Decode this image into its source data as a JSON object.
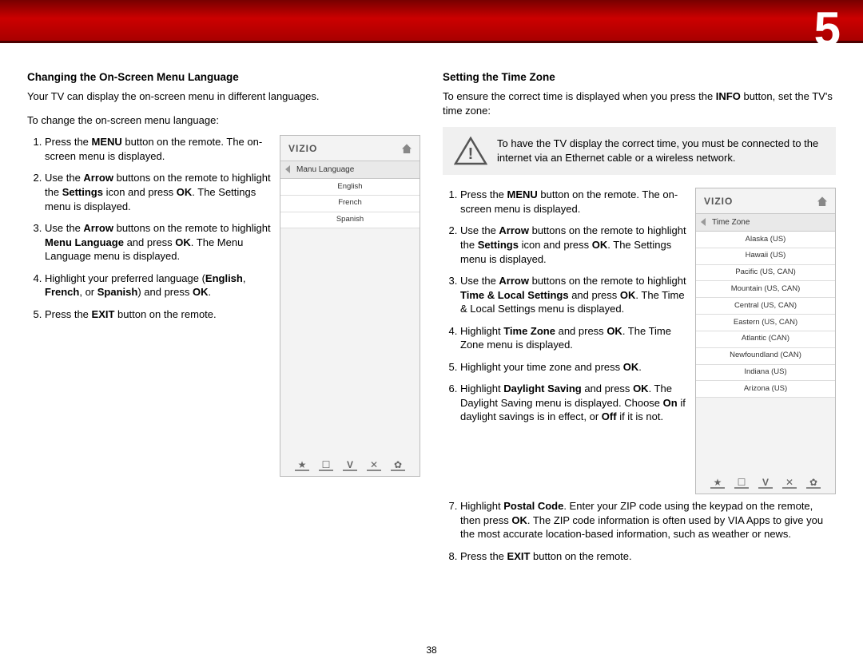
{
  "chapter_number": "5",
  "page_number": "38",
  "left": {
    "title": "Changing the On-Screen Menu Language",
    "intro": "Your TV can display the on-screen menu in different languages.",
    "subintro": "To change the on-screen menu language:",
    "steps": {
      "s1a": "Press the ",
      "s1b": "MENU",
      "s1c": " button on the remote. The on-screen menu is displayed.",
      "s2a": "Use the ",
      "s2b": "Arrow",
      "s2c": " buttons on the remote to highlight the ",
      "s2d": "Settings",
      "s2e": " icon and press ",
      "s2f": "OK",
      "s2g": ". The Settings menu is displayed.",
      "s3a": "Use the ",
      "s3b": "Arrow",
      "s3c": " buttons on the remote to highlight ",
      "s3d": "Menu Language",
      "s3e": " and press ",
      "s3f": "OK",
      "s3g": ". The Menu Language menu is displayed.",
      "s4a": "Highlight your preferred language (",
      "s4b": "English",
      "s4c": ", ",
      "s4d": "French",
      "s4e": ", or ",
      "s4f": "Spanish",
      "s4g": ") and press ",
      "s4h": "OK",
      "s4i": ".",
      "s5a": "Press the ",
      "s5b": "EXIT",
      "s5c": " button on the remote."
    },
    "panel": {
      "brand": "VIZIO",
      "menu_title": "Manu Language",
      "items": [
        "English",
        "French",
        "Spanish"
      ]
    }
  },
  "right": {
    "title": "Setting the Time Zone",
    "intro_a": "To ensure the correct time is displayed when you press the ",
    "intro_b": "INFO",
    "intro_c": " button, set the TV's time zone:",
    "warning": "To have the TV display the correct time, you must be connected to the internet via an Ethernet cable or a wireless network.",
    "steps": {
      "s1a": "Press the ",
      "s1b": "MENU",
      "s1c": " button on the remote. The on-screen menu is displayed.",
      "s2a": "Use the ",
      "s2b": "Arrow",
      "s2c": " buttons on the remote to highlight the ",
      "s2d": "Settings",
      "s2e": " icon and press ",
      "s2f": "OK",
      "s2g": ". The Settings menu is displayed.",
      "s3a": "Use the ",
      "s3b": "Arrow",
      "s3c": " buttons on the remote to highlight ",
      "s3d": "Time & Local Settings",
      "s3e": " and press ",
      "s3f": "OK",
      "s3g": ". The Time & Local Settings menu is displayed.",
      "s4a": "Highlight ",
      "s4b": "Time Zone",
      "s4c": " and press ",
      "s4d": "OK",
      "s4e": ". The Time Zone menu is displayed.",
      "s5a": "Highlight your time zone and press ",
      "s5b": "OK",
      "s5c": ".",
      "s6a": "Highlight ",
      "s6b": "Daylight Saving",
      "s6c": " and press ",
      "s6d": "OK",
      "s6e": ". The Daylight Saving menu is displayed. Choose ",
      "s6f": "On",
      "s6g": " if daylight savings is in effect, or ",
      "s6h": "Off",
      "s6i": " if it is not.",
      "s7a": "Highlight ",
      "s7b": "Postal Code",
      "s7c": ". Enter your ZIP code using the keypad on the remote, then press ",
      "s7d": "OK",
      "s7e": ". The ZIP code information is often used by VIA Apps to give you the most accurate location-based information, such as weather or news.",
      "s8a": "Press the ",
      "s8b": "EXIT",
      "s8c": " button on the remote."
    },
    "panel": {
      "brand": "VIZIO",
      "menu_title": "Time Zone",
      "items": [
        "Alaska (US)",
        "Hawaii (US)",
        "Pacific (US, CAN)",
        "Mountain (US, CAN)",
        "Central (US, CAN)",
        "Eastern (US, CAN)",
        "Atlantic (CAN)",
        "Newfoundland (CAN)",
        "Indiana (US)",
        "Arizona (US)"
      ]
    }
  },
  "footer_icons": {
    "star": "★",
    "cc": "☐",
    "v": "V",
    "x": "✕",
    "gear": "✿"
  }
}
